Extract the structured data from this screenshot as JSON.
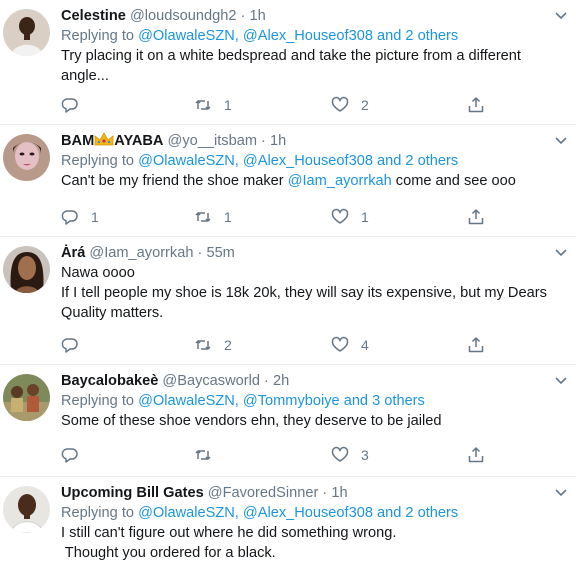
{
  "tweets": [
    {
      "name": "Celestine",
      "handle": "@loudsoundgh2",
      "sep": "·",
      "time": "1h",
      "replying_prefix": "Replying to",
      "replying_users": "@OlawaleSZN, @Alex_Houseof308",
      "replying_suffix": "and 2 others",
      "text": [
        "Try placing it on a white bedspread and take the picture from a different",
        "angle..."
      ],
      "replies": "",
      "retweets": "1",
      "likes": "2"
    },
    {
      "name": "BAM",
      "name_after": "AYABA",
      "handle": "@yo__itsbam",
      "sep": "·",
      "time": "1h",
      "replying_prefix": "Replying to",
      "replying_users": "@OlawaleSZN, @Alex_Houseof308",
      "replying_suffix": "and 2 others",
      "text_before": "Can't be my friend the shoe maker",
      "text_link": "@Iam_ayorrkah",
      "text_after": "come and see ooo",
      "replies": "1",
      "retweets": "1",
      "likes": "1"
    },
    {
      "name": "Ȧrá",
      "handle": "@Iam_ayorrkah",
      "sep": "·",
      "time": "55m",
      "text": [
        "Nawa oooo",
        "If I tell people my shoe is 18k 20k, they will say its expensive, but my Dears",
        "Quality matters."
      ],
      "replies": "",
      "retweets": "2",
      "likes": "4"
    },
    {
      "name": "Baycalobakeè",
      "handle": "@Baycasworld",
      "sep": "·",
      "time": "2h",
      "replying_prefix": "Replying to",
      "replying_users": "@OlawaleSZN, @Tommyboiye",
      "replying_suffix": "and 3 others",
      "text": [
        "Some of these shoe vendors ehn, they deserve to be jailed"
      ],
      "replies": "",
      "retweets": "",
      "likes": "3"
    },
    {
      "name": "Upcoming Bill Gates",
      "handle": "@FavoredSinner",
      "sep": "·",
      "time": "1h",
      "replying_prefix": "Replying to",
      "replying_users": "@OlawaleSZN, @Alex_Houseof308",
      "replying_suffix": "and 2 others",
      "text": [
        "I still can't figure out where he did something wrong.",
        " Thought you ordered for a black."
      ]
    }
  ],
  "colors": {
    "link": "#1b95e0",
    "muted": "#657786",
    "text": "#14171a",
    "divider": "#e6ecf0"
  },
  "icons": [
    "reply-icon",
    "retweet-icon",
    "like-icon",
    "share-icon",
    "chevron-down-icon",
    "crown-emoji"
  ]
}
